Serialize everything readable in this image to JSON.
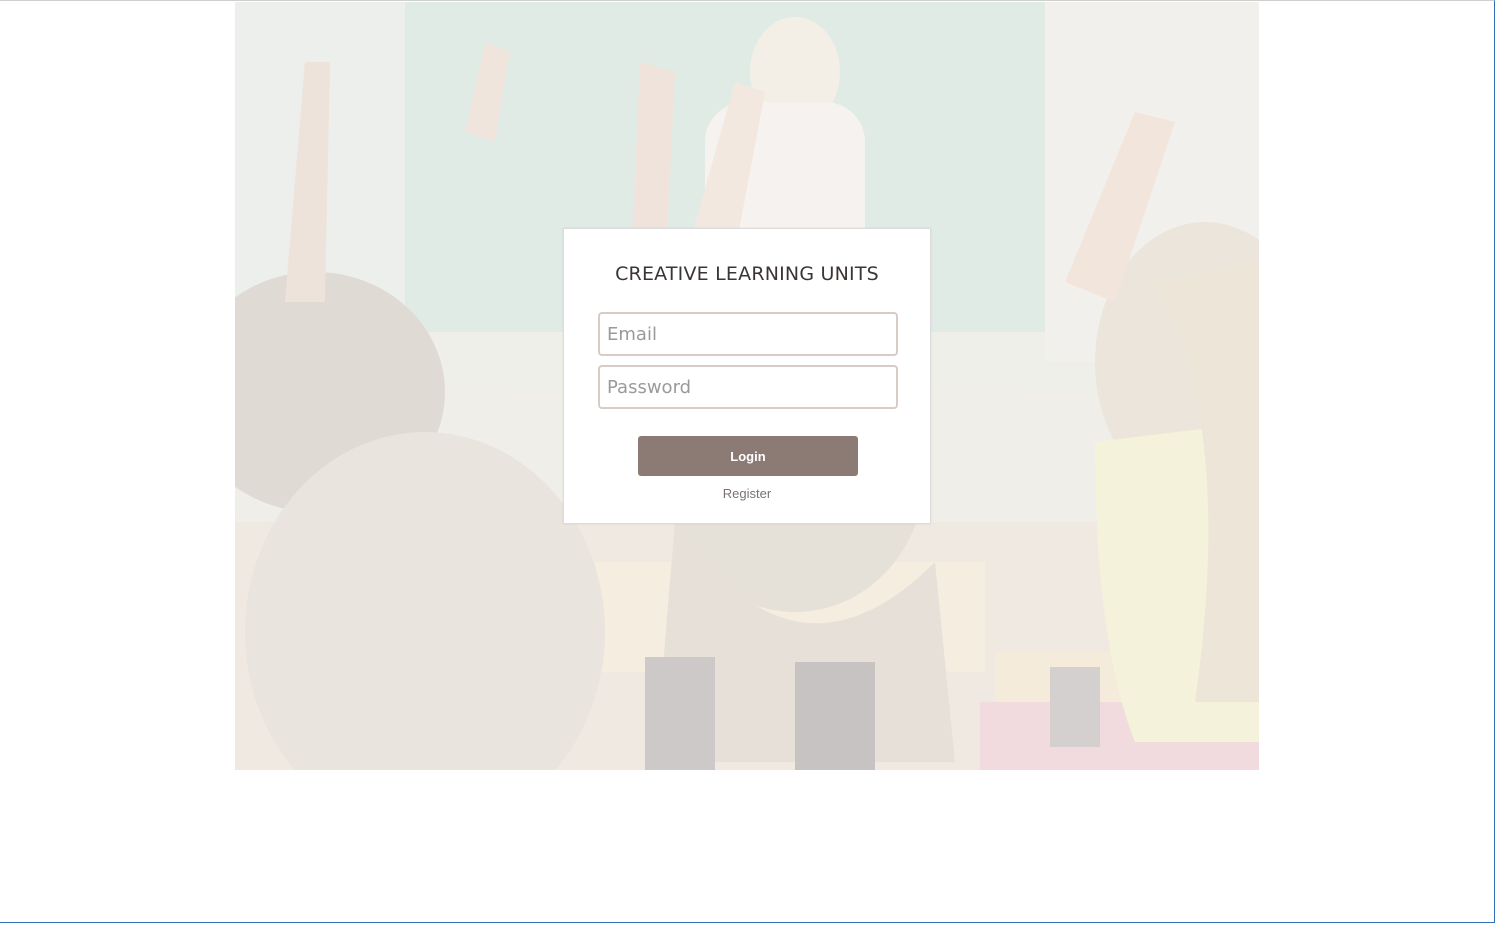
{
  "login": {
    "title": "CREATIVE LEARNING UNITS",
    "email_placeholder": "Email",
    "password_placeholder": "Password",
    "login_label": "Login",
    "register_label": "Register"
  },
  "colors": {
    "button": "#8c7b75",
    "field_border": "#d9cbc6",
    "title_text": "#3b3634"
  },
  "hero": {
    "image_subject": "classroom-raised-hands"
  }
}
